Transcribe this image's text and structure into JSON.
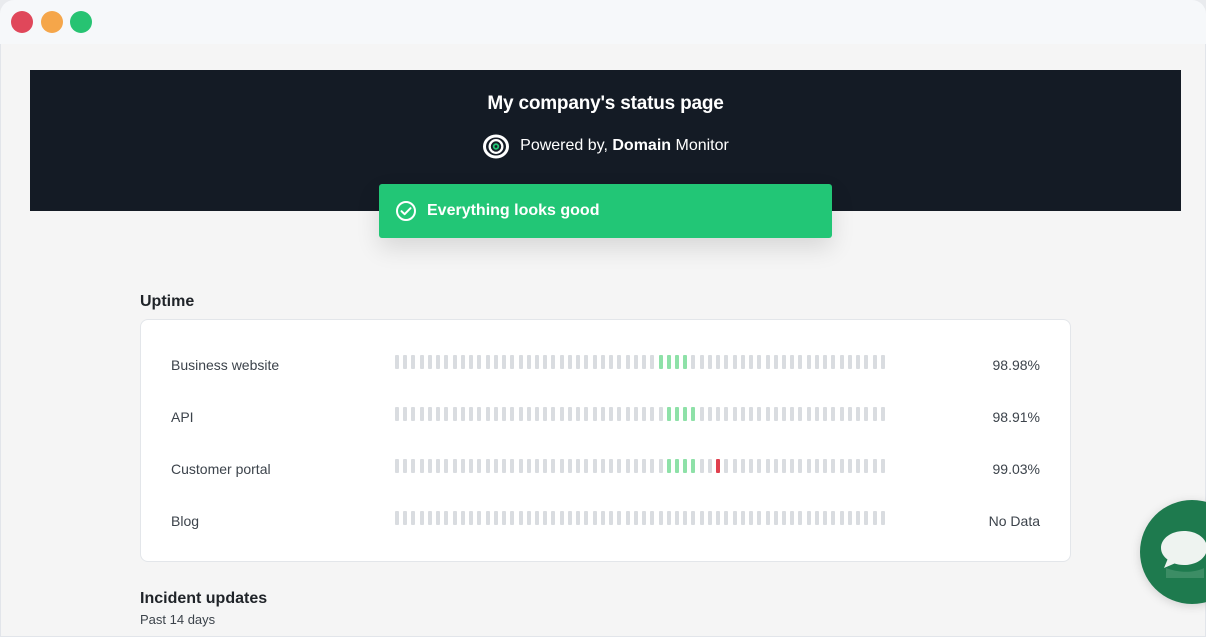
{
  "header": {
    "title": "My company's status page",
    "powered_prefix": "Powered by,",
    "powered_brand": "Domain",
    "powered_suffix": "Monitor",
    "logo_icon": "domain-monitor-logo-icon"
  },
  "status": {
    "message": "Everything looks good",
    "icon": "check-circle-icon",
    "color": "#22c676"
  },
  "uptime": {
    "title": "Uptime",
    "legend_colors": {
      "up": "#8ee1a8",
      "down": "#e0404e",
      "no_data": "#d9dce0"
    },
    "monitors": [
      {
        "name": "Business website",
        "value": "98.98%",
        "bars": "nnnnnnnnnnnnnnnnnnnnnnnnnnnnnnnnuuuunnnnnnnnnnnnnnnnnnnnnnnn"
      },
      {
        "name": "API",
        "value": "98.91%",
        "bars": "nnnnnnnnnnnnnnnnnnnnnnnnnnnnnnnnnuuuunnnnnnnnnnnnnnnnnnnnnnn"
      },
      {
        "name": "Customer portal",
        "value": "99.03%",
        "bars": "nnnnnnnnnnnnnnnnnnnnnnnnnnnnnnnnnuuuunndnnnnnnnnnnnnnnnnnnnn"
      },
      {
        "name": "Blog",
        "value": "No Data",
        "bars": "nnnnnnnnnnnnnnnnnnnnnnnnnnnnnnnnnnnnnnnnnnnnnnnnnnnnnnnnnnnn"
      }
    ]
  },
  "incidents": {
    "title": "Incident updates",
    "subtitle": "Past 14 days"
  },
  "chat": {
    "icon": "chat-bubble-icon"
  }
}
